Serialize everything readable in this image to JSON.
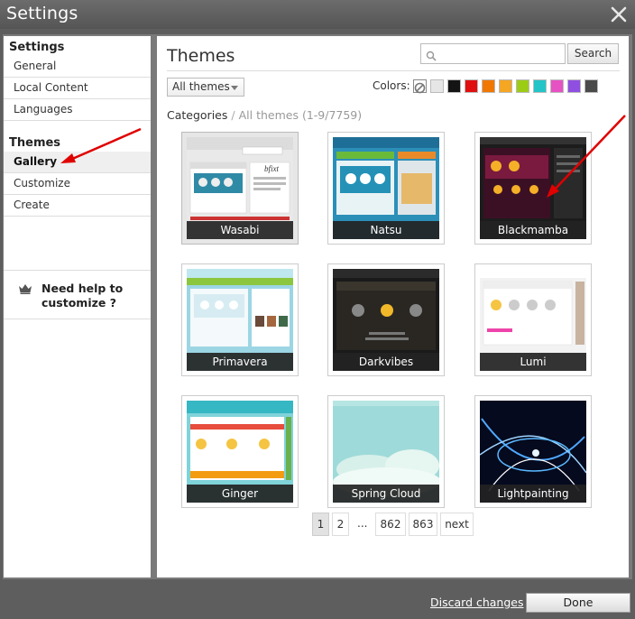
{
  "window": {
    "title": "Settings"
  },
  "sidebar": {
    "settings_heading": "Settings",
    "settings_items": [
      "General",
      "Local Content",
      "Languages"
    ],
    "themes_heading": "Themes",
    "themes_items": [
      "Gallery",
      "Customize",
      "Create"
    ],
    "active_item": "Gallery",
    "help_text": "Need help to customize ?"
  },
  "main": {
    "heading": "Themes",
    "search": {
      "placeholder": "",
      "value": "",
      "button_label": "Search"
    },
    "filter_dropdown": "All themes",
    "colors_label": "Colors:",
    "color_swatches": [
      "none",
      "#e6e6e6",
      "#141414",
      "#e01010",
      "#f07800",
      "#f5a623",
      "#9ccc16",
      "#22c4c8",
      "#e652c4",
      "#8f4fe0",
      "#4a4a4a"
    ],
    "breadcrumb": {
      "root": "Categories",
      "separator": "/",
      "current": "All themes (1-9/7759)"
    },
    "themes": [
      "Wasabi",
      "Natsu",
      "Blackmamba",
      "Primavera",
      "Darkvibes",
      "Lumi",
      "Ginger",
      "Spring Cloud",
      "Lightpainting"
    ],
    "selected_theme": "Wasabi",
    "pagination": {
      "pages": [
        "1",
        "2"
      ],
      "ellipsis": "...",
      "last_pages": [
        "862",
        "863"
      ],
      "next_label": "next",
      "current": "1"
    }
  },
  "footer": {
    "discard_label": "Discard changes",
    "done_label": "Done"
  },
  "annotations": {
    "arrow_color": "#e00000"
  }
}
